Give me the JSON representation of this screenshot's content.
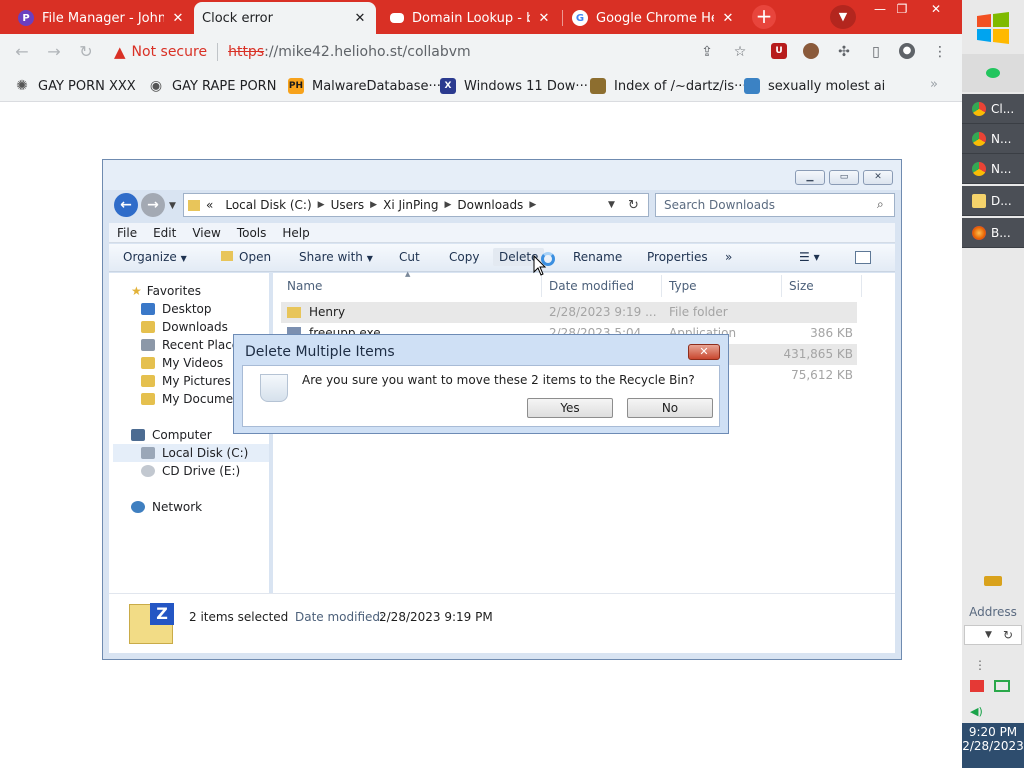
{
  "browser": {
    "tabs": [
      {
        "title": "File Manager - Johnn",
        "fav_letter": "P",
        "active": false
      },
      {
        "title": "Clock error",
        "fav_letter": "",
        "active": true
      },
      {
        "title": "Domain Lookup - bgp",
        "fav_letter": "",
        "active": false
      },
      {
        "title": "Google Chrome Help",
        "fav_letter": "G",
        "active": false
      }
    ],
    "new_tab": "+",
    "omnibox": {
      "warning": "Not secure",
      "url_scheme": "https",
      "url_rest": "://mike42.helioho.st/collabvm"
    },
    "bookmarks": [
      {
        "label": "GAY PORN XXX",
        "icon": "globe-icon"
      },
      {
        "label": "GAY RAPE PORN",
        "icon": "globe-icon"
      },
      {
        "label": "MalwareDatabase···",
        "icon": "ph-icon",
        "icon_text": "PH"
      },
      {
        "label": "Windows 11 Dow···",
        "icon": "x-icon",
        "icon_text": "X"
      },
      {
        "label": "Index of /~dartz/is···",
        "icon": "folder-icon"
      },
      {
        "label": "sexually molest ai",
        "icon": "page-icon"
      }
    ],
    "colors": {
      "tab_strip": "#d93025",
      "toolbar": "#f1f3f4",
      "warning": "#d93025"
    }
  },
  "explorer": {
    "breadcrumb": [
      "Local Disk (C:)",
      "Users",
      "Xi JinPing",
      "Downloads"
    ],
    "breadcrumb_prefix": "«",
    "search_placeholder": "Search Downloads",
    "menu": [
      "File",
      "Edit",
      "View",
      "Tools",
      "Help"
    ],
    "commands": {
      "organize": "Organize",
      "open": "Open",
      "share": "Share with",
      "cut": "Cut",
      "copy": "Copy",
      "delete": "Delete",
      "rename": "Rename",
      "properties": "Properties",
      "more": "»"
    },
    "nav": {
      "favorites": "Favorites",
      "desktop": "Desktop",
      "downloads": "Downloads",
      "recent": "Recent Place",
      "videos": "My Videos",
      "pictures": "My Pictures",
      "documents": "My Documen",
      "computer": "Computer",
      "local_disk": "Local Disk (C:)",
      "cd_drive": "CD Drive (E:)",
      "network": "Network"
    },
    "columns": {
      "name": "Name",
      "date": "Date modified",
      "type": "Type",
      "size": "Size"
    },
    "files": [
      {
        "name": "Henry",
        "date": "2/28/2023 9:19 ...",
        "type": "File folder",
        "size": ""
      },
      {
        "name": "freeupp.exe",
        "date": "2/28/2023 5:04 ...",
        "type": "Application",
        "size": "386 KB"
      },
      {
        "name": "",
        "date": "",
        "type": "",
        "size": "431,865 KB"
      },
      {
        "name": "",
        "date": "",
        "type": "",
        "size": "75,612 KB"
      }
    ],
    "details": {
      "selected": "2 items selected",
      "date_label": "Date modified:",
      "date_value": "2/28/2023 9:19 PM"
    }
  },
  "dialog": {
    "title": "Delete Multiple Items",
    "message": "Are you sure you want to move these 2 items to the Recycle Bin?",
    "yes": "Yes",
    "no": "No",
    "close": "✕"
  },
  "taskbar": {
    "tasks": [
      {
        "label": "Cl...",
        "icon": "chrome-icon"
      },
      {
        "label": "N...",
        "icon": "chrome-icon"
      },
      {
        "label": "N...",
        "icon": "chrome-icon"
      },
      {
        "label": "D...",
        "icon": "document-icon"
      },
      {
        "label": "B...",
        "icon": "firefox-icon"
      }
    ],
    "address_label": "Address",
    "clock_time": "9:20 PM",
    "clock_date": "2/28/2023"
  }
}
